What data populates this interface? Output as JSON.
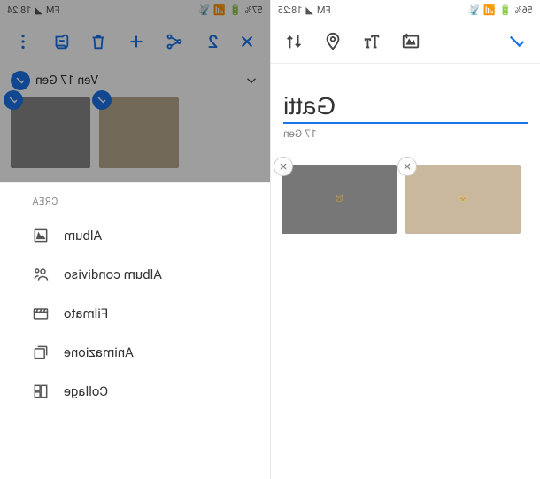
{
  "left": {
    "status": {
      "time": "18:25",
      "battery": "56%",
      "carrier": "FM"
    },
    "toolbar": {
      "done_action": "✓"
    },
    "title": "Gatti",
    "date_label": "17 Gen",
    "thumbs": [
      {
        "alt": "cat photo sepia",
        "tone": "sepia"
      },
      {
        "alt": "cat photo bw",
        "tone": "bw"
      }
    ]
  },
  "right": {
    "status": {
      "time": "18:24",
      "battery": "57%",
      "carrier": "FM"
    },
    "selected_count": "2",
    "date_header": "Ven 17 Gen",
    "thumbs": [
      {
        "alt": "cat photo sepia selected",
        "tone": "sepia"
      },
      {
        "alt": "cat photo bw selected",
        "tone": "bw"
      }
    ],
    "sheet": {
      "header": "CREA",
      "items": [
        {
          "label": "Album",
          "icon": "album-icon"
        },
        {
          "label": "Album condiviso",
          "icon": "shared-album-icon"
        },
        {
          "label": "Filmato",
          "icon": "movie-icon"
        },
        {
          "label": "Animazione",
          "icon": "animation-icon"
        },
        {
          "label": "Collage",
          "icon": "collage-icon"
        }
      ]
    }
  }
}
